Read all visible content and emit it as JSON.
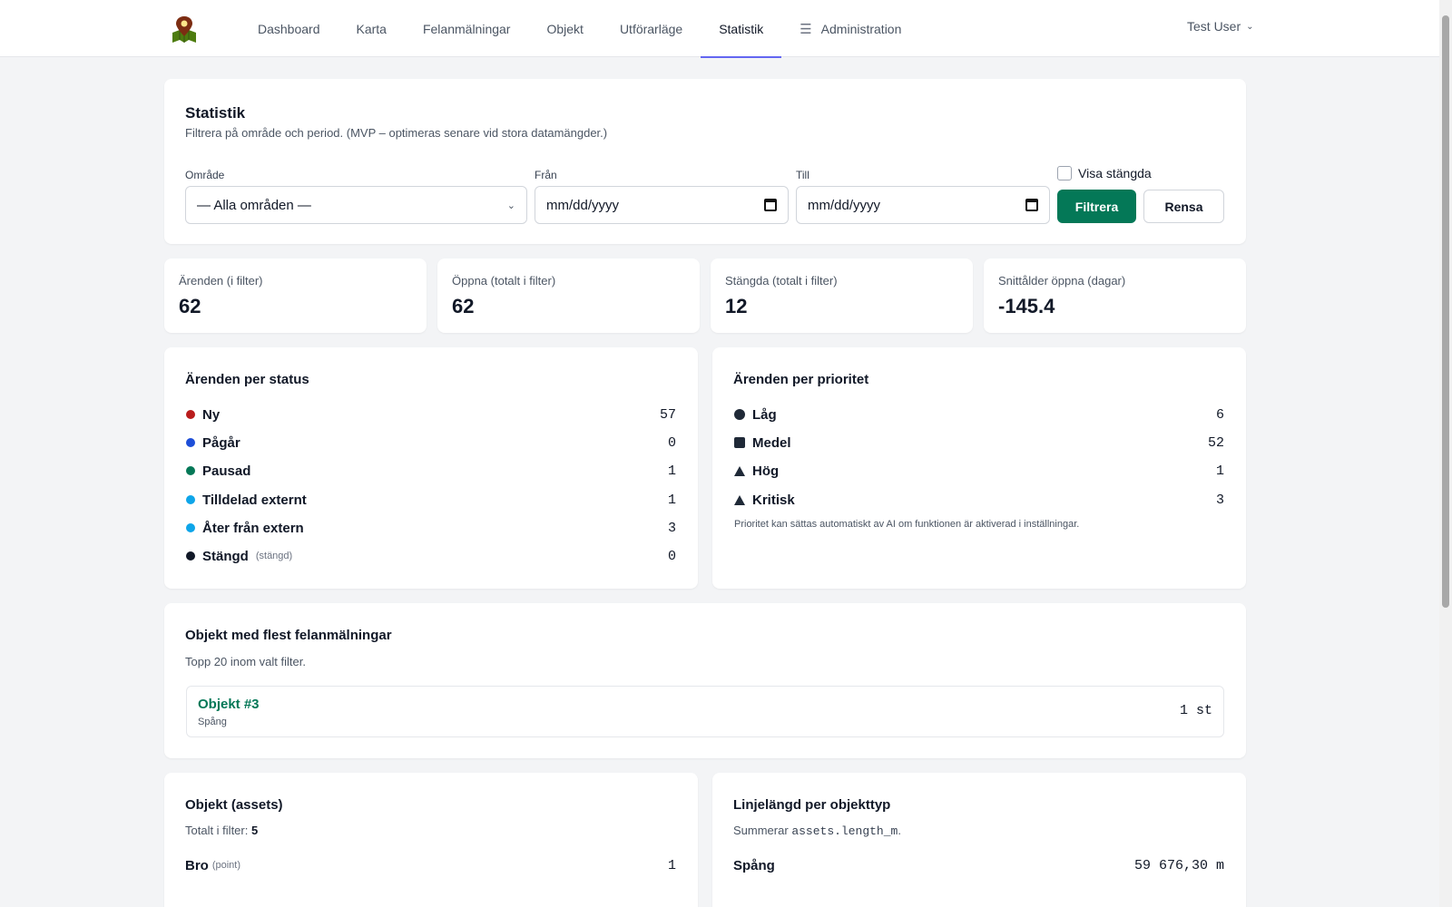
{
  "nav": {
    "items": [
      {
        "label": "Dashboard",
        "name": "nav-dashboard"
      },
      {
        "label": "Karta",
        "name": "nav-karta"
      },
      {
        "label": "Felanmälningar",
        "name": "nav-felanmalningar"
      },
      {
        "label": "Objekt",
        "name": "nav-objekt"
      },
      {
        "label": "Utförarläge",
        "name": "nav-utforarlage"
      },
      {
        "label": "Statistik",
        "name": "nav-statistik"
      }
    ],
    "admin_label": "Administration",
    "user_label": "Test User",
    "active": "Statistik",
    "accent": "#6366f1"
  },
  "filter": {
    "title": "Statistik",
    "subtitle": "Filtrera på område och period. (MVP – optimeras senare vid stora datamängder.)",
    "area_label": "Område",
    "area_value": "— Alla områden —",
    "from_label": "Från",
    "from_value": "mm/dd/yyyy",
    "to_label": "Till",
    "to_value": "mm/dd/yyyy",
    "show_closed_label": "Visa stängda",
    "show_closed_checked": false,
    "filter_button": "Filtrera",
    "clear_button": "Rensa",
    "primary_color": "#047857"
  },
  "kpis": [
    {
      "label": "Ärenden (i filter)",
      "value": "62"
    },
    {
      "label": "Öppna (totalt i filter)",
      "value": "62"
    },
    {
      "label": "Stängda (totalt i filter)",
      "value": "12"
    },
    {
      "label": "Snittålder öppna (dagar)",
      "value": "-145.4"
    }
  ],
  "status": {
    "title": "Ärenden per status",
    "rows": [
      {
        "label": "Ny",
        "value": "57",
        "color": "#b91c1c",
        "suffix": ""
      },
      {
        "label": "Pågår",
        "value": "0",
        "color": "#1d4ed8",
        "suffix": ""
      },
      {
        "label": "Pausad",
        "value": "1",
        "color": "#047857",
        "suffix": ""
      },
      {
        "label": "Tilldelad externt",
        "value": "1",
        "color": "#0ea5e9",
        "suffix": ""
      },
      {
        "label": "Åter från extern",
        "value": "3",
        "color": "#0ea5e9",
        "suffix": ""
      },
      {
        "label": "Stängd",
        "value": "0",
        "color": "#111827",
        "suffix": "(stängd)"
      }
    ]
  },
  "priority": {
    "title": "Ärenden per prioritet",
    "rows": [
      {
        "label": "Låg",
        "value": "6",
        "icon": "circle-icon"
      },
      {
        "label": "Medel",
        "value": "52",
        "icon": "square-icon"
      },
      {
        "label": "Hög",
        "value": "1",
        "icon": "triangle-icon"
      },
      {
        "label": "Kritisk",
        "value": "3",
        "icon": "triangle-icon"
      }
    ],
    "note": "Prioritet kan sättas automatiskt av AI om funktionen är aktiverad i inställningar."
  },
  "top_objects": {
    "title": "Objekt med flest felanmälningar",
    "subtitle": "Topp 20 inom valt filter.",
    "items": [
      {
        "name": "Objekt #3",
        "type": "Spång",
        "count": "1 st"
      }
    ]
  },
  "assets": {
    "title": "Objekt (assets)",
    "total_label": "Totalt i filter:",
    "total_value": "5",
    "rows": [
      {
        "label": "Bro",
        "suffix": "(point)",
        "value": "1"
      }
    ]
  },
  "line_length": {
    "title": "Linjelängd per objekttyp",
    "subtitle_prefix": "Summerar",
    "subtitle_code": "assets.length_m",
    "subtitle_suffix": ".",
    "rows": [
      {
        "label": "Spång",
        "value": "59 676,30 m"
      }
    ]
  }
}
